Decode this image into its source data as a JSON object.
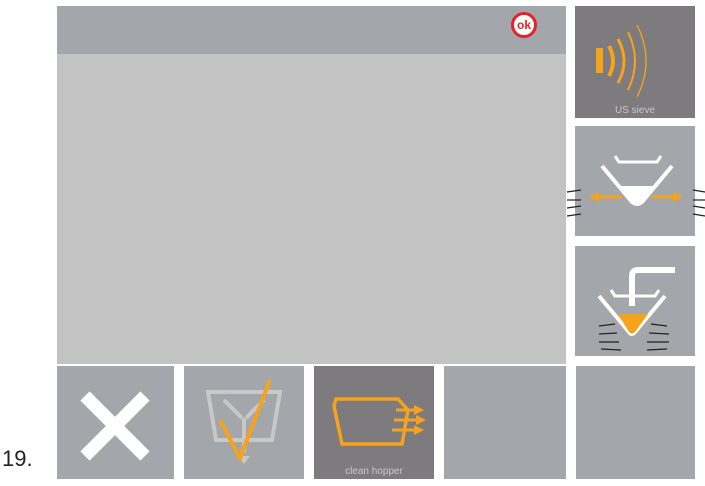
{
  "step_number": "19.",
  "status": {
    "ok_label": "ok"
  },
  "side_buttons": [
    {
      "label": "US sieve",
      "icon": "ultrasonic-sieve-icon"
    },
    {
      "label": "",
      "icon": "hopper-vibrate-spread-icon"
    },
    {
      "label": "",
      "icon": "hopper-vibrate-fill-icon"
    }
  ],
  "bottom_buttons": [
    {
      "label": "",
      "icon": "cancel-x-icon"
    },
    {
      "label": "",
      "icon": "hopper-confirm-check-icon"
    },
    {
      "label": "clean hopper",
      "icon": "clean-hopper-icon"
    },
    {
      "label": "",
      "icon": ""
    },
    {
      "label": "",
      "icon": ""
    }
  ],
  "colors": {
    "accent": "#f7a21b",
    "panel": "#a3a6aa",
    "panel_active": "#7d7b7d",
    "main": "#c4c3c4",
    "ok_red": "#e2232a"
  }
}
